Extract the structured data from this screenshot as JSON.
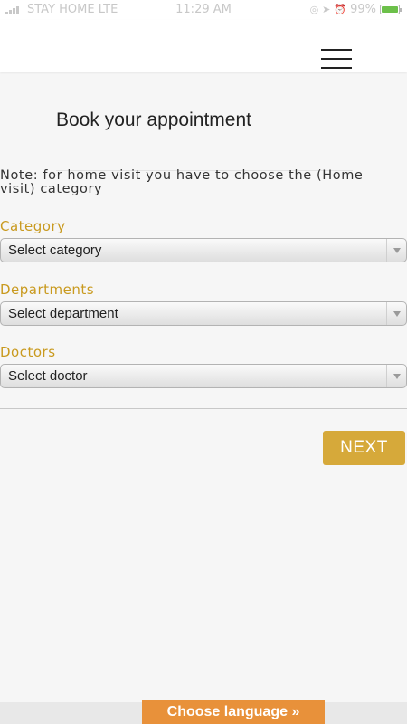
{
  "status_bar": {
    "carrier": "STAY HOME  LTE",
    "time": "11:29 AM",
    "battery": "99%",
    "battery_level": 0.99,
    "icons": [
      "signal-icon",
      "lock-rotation-icon",
      "location-arrow-icon",
      "alarm-icon",
      "battery-icon"
    ]
  },
  "header": {
    "menu_icon": "hamburger-menu-icon"
  },
  "page": {
    "title": "Book your appointment",
    "note": "Note: for home visit you have to choose the (Home visit) category"
  },
  "form": {
    "category": {
      "label": "Category",
      "selected": "Select category"
    },
    "departments": {
      "label": "Departments",
      "selected": "Select department"
    },
    "doctors": {
      "label": "Doctors",
      "selected": "Select doctor"
    }
  },
  "actions": {
    "next_label": "NEXT"
  },
  "footer": {
    "language_label": "Choose language »"
  },
  "colors": {
    "accent_gold": "#d6a93a",
    "label_gold": "#c99a1f",
    "language_orange": "#e8913a",
    "background": "#f6f6f6"
  }
}
